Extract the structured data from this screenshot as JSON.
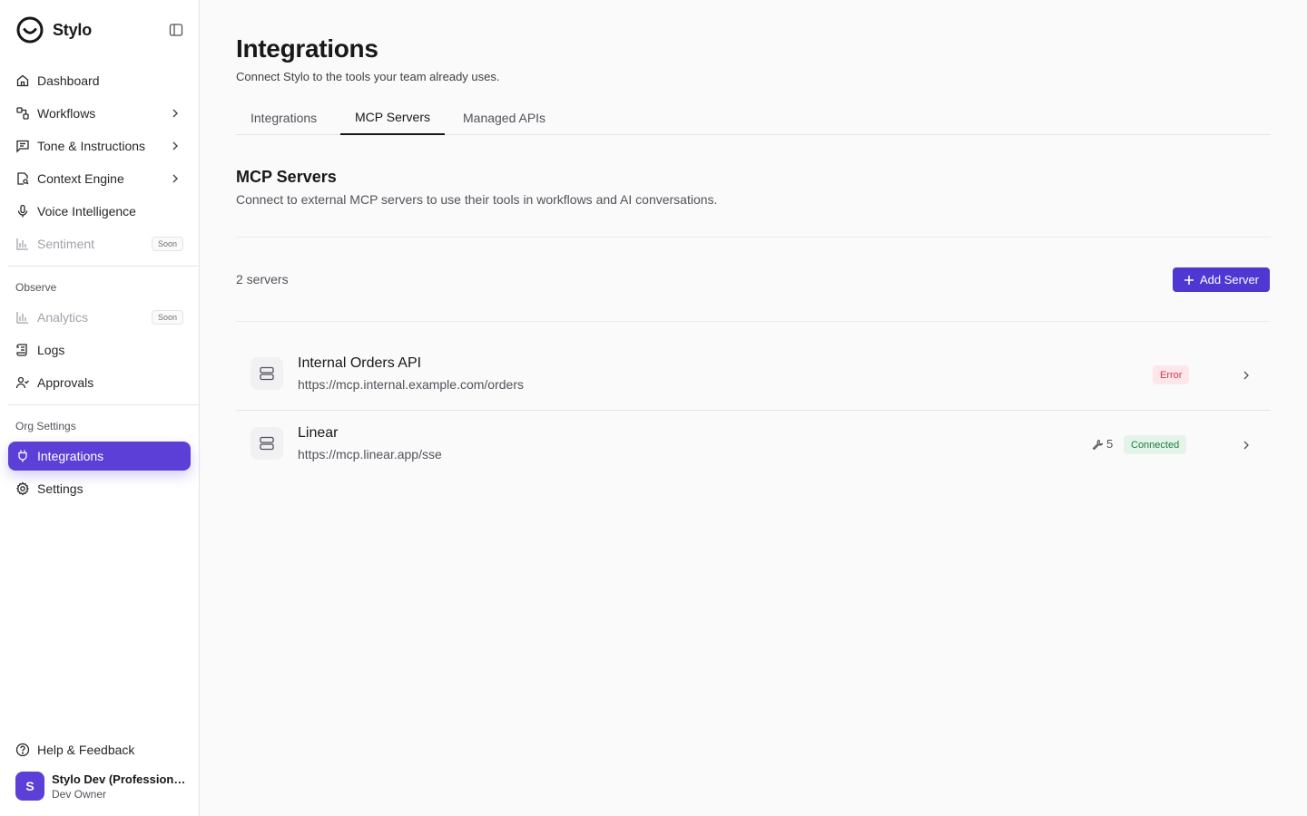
{
  "brand": {
    "name": "Stylo"
  },
  "sidebar": {
    "items": [
      {
        "label": "Dashboard"
      },
      {
        "label": "Workflows"
      },
      {
        "label": "Tone & Instructions"
      },
      {
        "label": "Context Engine"
      },
      {
        "label": "Voice Intelligence"
      },
      {
        "label": "Sentiment",
        "badge": "Soon"
      }
    ],
    "observe": {
      "label": "Observe",
      "items": [
        {
          "label": "Analytics",
          "badge": "Soon"
        },
        {
          "label": "Logs"
        },
        {
          "label": "Approvals"
        }
      ]
    },
    "org": {
      "label": "Org Settings",
      "items": [
        {
          "label": "Integrations"
        },
        {
          "label": "Settings"
        }
      ]
    },
    "help": "Help & Feedback",
    "user": {
      "initial": "S",
      "name": "Stylo Dev (Professional)",
      "role": "Dev Owner"
    }
  },
  "page": {
    "title": "Integrations",
    "subtitle": "Connect Stylo to the tools your team already uses.",
    "tabs": [
      {
        "label": "Integrations"
      },
      {
        "label": "MCP Servers"
      },
      {
        "label": "Managed APIs"
      }
    ]
  },
  "mcp": {
    "title": "MCP Servers",
    "description": "Connect to external MCP servers to use their tools in workflows and AI conversations.",
    "count": "2 servers",
    "add_label": "Add Server",
    "servers": [
      {
        "name": "Internal Orders API",
        "url": "https://mcp.internal.example.com/orders",
        "status": "Error"
      },
      {
        "name": "Linear",
        "url": "https://mcp.linear.app/sse",
        "status": "Connected",
        "tools": "5"
      }
    ]
  },
  "colors": {
    "accent": "#5b3fd6",
    "button": "#4f38d2",
    "error": "#d9334f",
    "success": "#1f7a43"
  }
}
